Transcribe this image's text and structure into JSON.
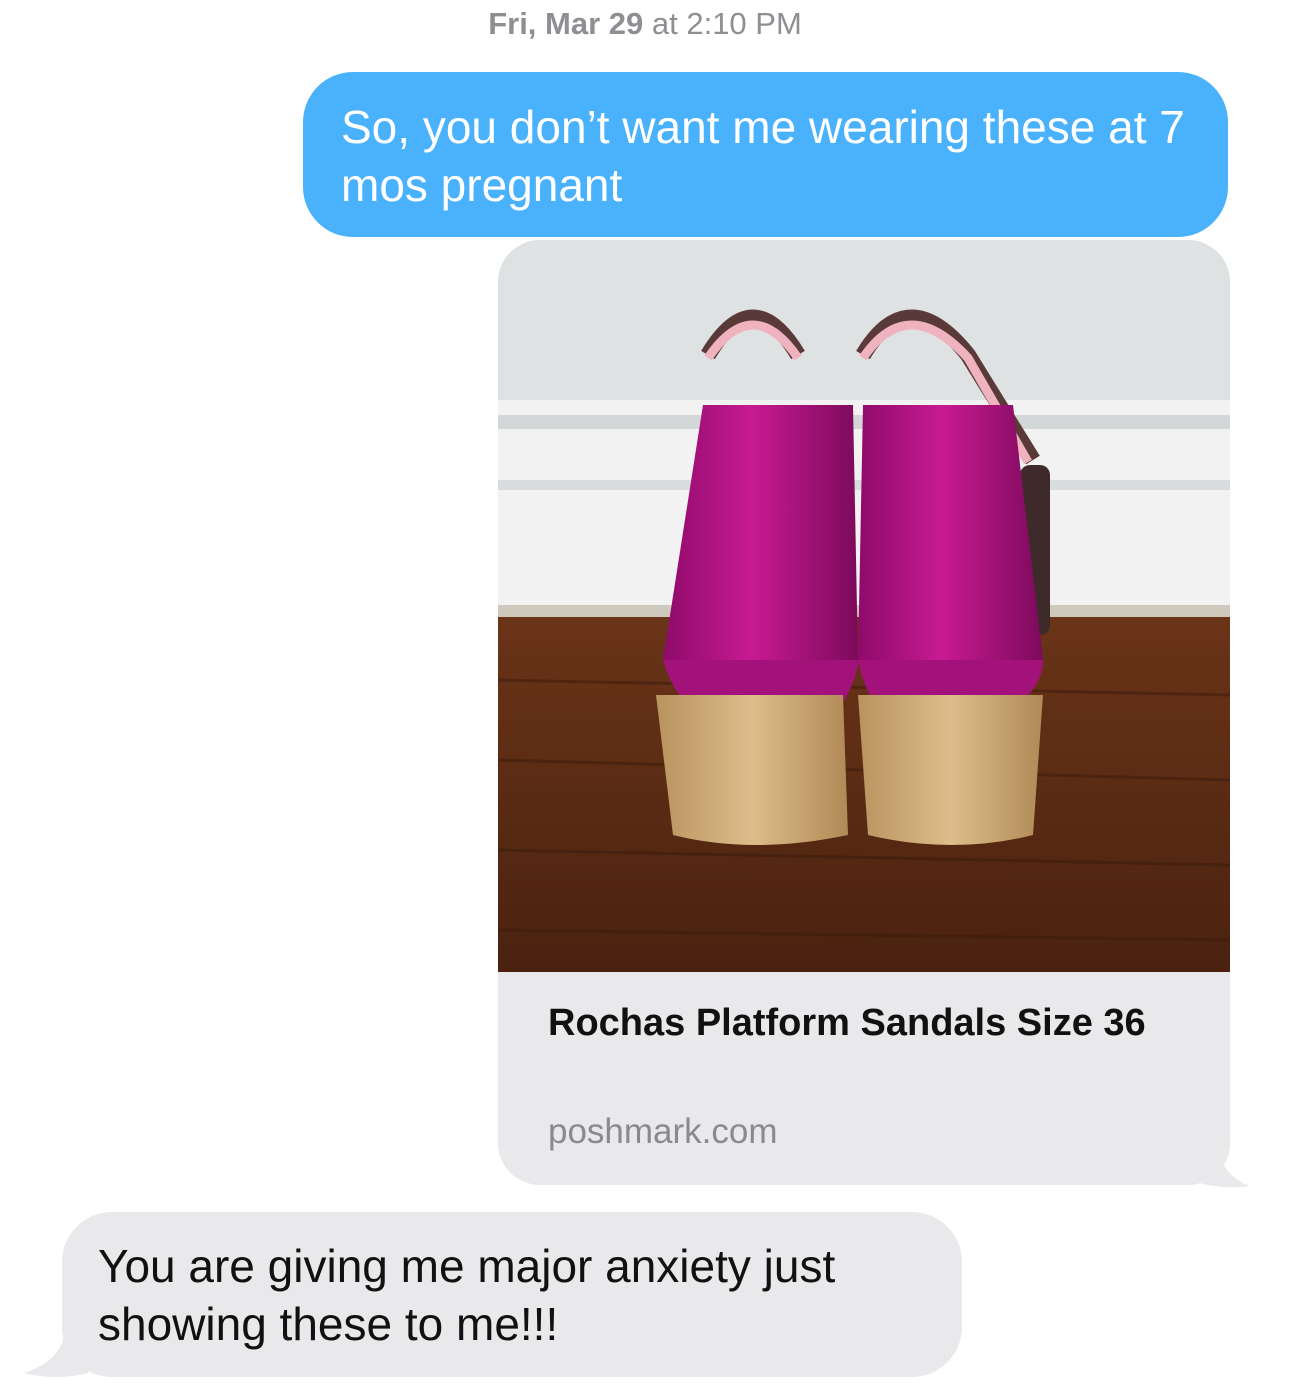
{
  "thread": {
    "timestamp_day": "Fri, Mar 29",
    "timestamp_time": "at 2:10 PM"
  },
  "messages": [
    {
      "direction": "outgoing",
      "text": "So, you don’t want me wearing these at 7 mos pregnant"
    },
    {
      "direction": "outgoing",
      "type": "link-preview",
      "title": "Rochas Platform Sandals Size 36",
      "domain": "poshmark.com",
      "image": "pink-platform-sandals-photo"
    },
    {
      "direction": "incoming",
      "text": "You are giving me major anxiety just showing these to me!!!"
    }
  ],
  "colors": {
    "outgoing_bubble": "#4ab1fc",
    "incoming_bubble": "#e9e9eb",
    "timestamp": "#8e8e93",
    "link_domain": "#8a8a8e"
  }
}
